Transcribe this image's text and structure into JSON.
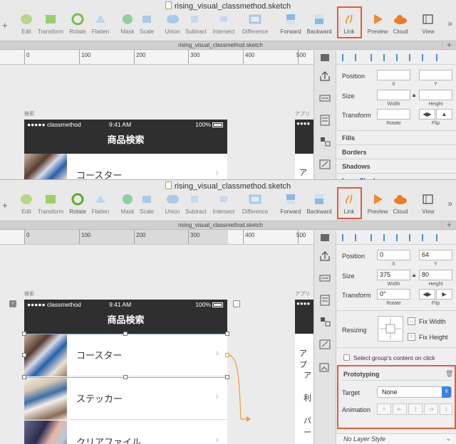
{
  "top": {
    "window_title": "rising_visual_classmethod.sketch",
    "toolbar": {
      "items": [
        {
          "label": "Edit",
          "icon": "edit-icon"
        },
        {
          "label": "Transform",
          "icon": "transform-icon"
        },
        {
          "label": "Rotate",
          "icon": "rotate-icon"
        },
        {
          "label": "Flatten",
          "icon": "flatten-icon"
        },
        {
          "label": "Mask",
          "icon": "mask-icon"
        },
        {
          "label": "Scale",
          "icon": "scale-icon"
        },
        {
          "label": "Union",
          "icon": "union-icon"
        },
        {
          "label": "Subtract",
          "icon": "subtract-icon"
        },
        {
          "label": "Intersect",
          "icon": "intersect-icon"
        },
        {
          "label": "Difference",
          "icon": "difference-icon"
        },
        {
          "label": "Forward",
          "icon": "forward-icon"
        },
        {
          "label": "Backward",
          "icon": "backward-icon"
        },
        {
          "label": "Link",
          "icon": "link-icon"
        },
        {
          "label": "Preview",
          "icon": "preview-icon"
        },
        {
          "label": "Cloud",
          "icon": "cloud-icon"
        },
        {
          "label": "View",
          "icon": "view-icon"
        }
      ]
    },
    "tab_title": "rising_visual_classmethod.sketch",
    "ruler": [
      "0",
      "100",
      "200",
      "300",
      "400",
      "500"
    ],
    "artboard_label": "検索",
    "artboard2_label": "アプリ",
    "status": {
      "carrier": "●●●●● classmethod",
      "time": "9:41 AM",
      "battery": "100%"
    },
    "nav_title": "商品検索",
    "rows": [
      {
        "label": "コースター"
      }
    ],
    "partial_texts": [
      "アプ"
    ],
    "inspector": {
      "position_label": "Position",
      "x_label": "X",
      "y_label": "Y",
      "size_label": "Size",
      "width_label": "Width",
      "height_label": "Height",
      "transform_label": "Transform",
      "rotate_label": "Rotate",
      "flip_label": "Flip",
      "fills_label": "Fills",
      "borders_label": "Borders",
      "shadows_label": "Shadows",
      "inner_shadows_label": "Inner Shadows"
    }
  },
  "bottom": {
    "window_title": "rising_visual_classmethod.sketch",
    "tab_title": "rising_visual_classmethod.sketch",
    "ruler": [
      "0",
      "100",
      "200",
      "300",
      "400",
      "500"
    ],
    "artboard_label": "検索",
    "artboard2_label": "アプリ",
    "status": {
      "carrier": "●●●●● classmethod",
      "time": "9:41 AM",
      "battery": "100%"
    },
    "nav_title": "商品検索",
    "rows": [
      {
        "label": "コースター"
      },
      {
        "label": "ステッカー"
      },
      {
        "label": "クリアファイル"
      }
    ],
    "partial_texts": [
      "アプ",
      "ア",
      "利",
      "バー"
    ],
    "inspector": {
      "position_label": "Position",
      "x_value": "0",
      "y_value": "64",
      "x_label": "X",
      "y_label": "Y",
      "size_label": "Size",
      "width_value": "375",
      "height_value": "80",
      "width_label": "Width",
      "height_label": "Height",
      "transform_label": "Transform",
      "rotate_value": "0°",
      "rotate_label": "Rotate",
      "flip_label": "Flip",
      "resizing_label": "Resizing",
      "fix_width": "Fix Width",
      "fix_height": "Fix Height",
      "select_group_label": "Select group's content on click",
      "prototyping_title": "Prototyping",
      "target_label": "Target",
      "target_value": "None",
      "animation_label": "Animation",
      "layer_style": "No Layer Style"
    }
  },
  "colors": {
    "highlight": "#e85a3a",
    "dark_bar": "#2f2f2f",
    "accent": "#3b82e0",
    "connector": "#f0a030"
  }
}
